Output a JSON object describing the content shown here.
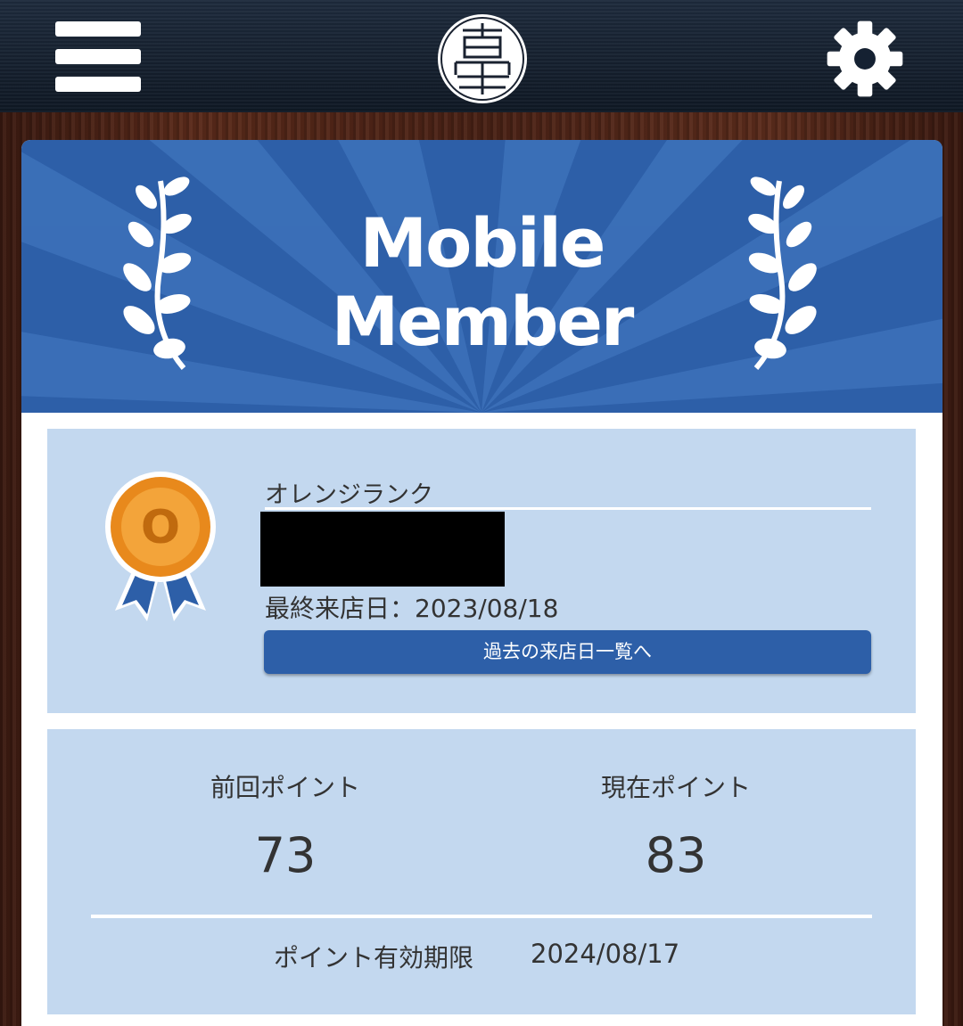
{
  "header": {
    "menu_icon": "hamburger-menu-icon",
    "logo_icon": "shop-logo-seal",
    "settings_icon": "gear-icon"
  },
  "banner": {
    "line1": "Mobile",
    "line2": "Member",
    "colors": {
      "background": "#2d5fa8",
      "rays": "#3f74bd"
    }
  },
  "member": {
    "rank_name": "オレンジランク",
    "medal_letter": "O",
    "last_visit": "最終来店日：2023/08/18",
    "history_button_label": "過去の来店日一覧へ"
  },
  "points": {
    "previous_label": "前回ポイント",
    "previous_value": "73",
    "current_label": "現在ポイント",
    "current_value": "83",
    "expiry_label": "ポイント有効期限",
    "expiry_date": "2024/08/17"
  },
  "colors": {
    "accent": "#2d5fa8",
    "panel": "#c3d8ef",
    "header": "#152132"
  }
}
